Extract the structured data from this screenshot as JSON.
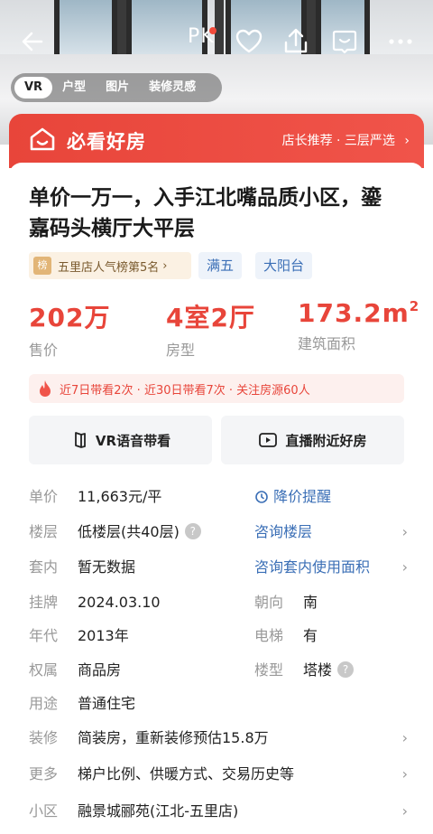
{
  "header": {
    "pk_label": "PK"
  },
  "media_tabs": [
    {
      "label": "VR",
      "active": true
    },
    {
      "label": "户型",
      "active": false
    },
    {
      "label": "图片",
      "active": false
    },
    {
      "label": "装修灵感",
      "active": false
    }
  ],
  "banner": {
    "brand": "必看好房",
    "recommend": "店长推荐 · 三层严选"
  },
  "listing": {
    "title": "单价一万一，入手江北嘴品质小区，鎏嘉码头横厅大平层",
    "rank_icon": "榜",
    "rank": "五里店人气榜第5名",
    "tags": [
      "满五",
      "大阳台"
    ],
    "stats": [
      {
        "value": "202万",
        "label": "售价"
      },
      {
        "value": "4室2厅",
        "label": "房型"
      },
      {
        "value": "173.2m",
        "sup": "2",
        "label": "建筑面积"
      }
    ],
    "heat": "近7日带看2次 · 近30日带看7次 · 关注房源60人",
    "buttons": {
      "vr": "VR语音带看",
      "live": "直播附近好房"
    },
    "details": {
      "unit_price": {
        "key": "单价",
        "value": "11,663元/平",
        "link": "降价提醒"
      },
      "floor": {
        "key": "楼层",
        "value": "低楼层(共40层)",
        "link": "咨询楼层"
      },
      "inner": {
        "key": "套内",
        "value": "暂无数据",
        "link": "咨询套内使用面积"
      },
      "listed": {
        "key": "挂牌",
        "value": "2024.03.10",
        "key2": "朝向",
        "value2": "南"
      },
      "year": {
        "key": "年代",
        "value": "2013年",
        "key2": "电梯",
        "value2": "有"
      },
      "ownership": {
        "key": "权属",
        "value": "商品房",
        "key2": "楼型",
        "value2": "塔楼"
      },
      "usage": {
        "key": "用途",
        "value": "普通住宅"
      },
      "decoration": {
        "key": "装修",
        "value": "简装房，重新装修预估15.8万"
      },
      "more": {
        "key": "更多",
        "value": "梯户比例、供暖方式、交易历史等"
      },
      "community": {
        "key": "小区",
        "value": "融景城郦苑(江北-五里店)"
      }
    }
  },
  "colors": {
    "accent_red": "#e8453a",
    "link_blue": "#3b6fb6",
    "muted_gray": "#999999"
  }
}
